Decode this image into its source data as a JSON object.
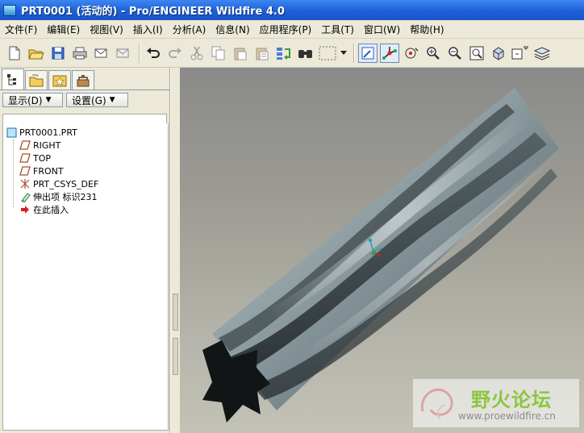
{
  "window": {
    "title": "PRT0001 (活动的) - Pro/ENGINEER Wildfire 4.0"
  },
  "menubar": {
    "items": [
      {
        "label": "文件(F)"
      },
      {
        "label": "编辑(E)"
      },
      {
        "label": "视图(V)"
      },
      {
        "label": "插入(I)"
      },
      {
        "label": "分析(A)"
      },
      {
        "label": "信息(N)"
      },
      {
        "label": "应用程序(P)"
      },
      {
        "label": "工具(T)"
      },
      {
        "label": "窗口(W)"
      },
      {
        "label": "帮助(H)"
      }
    ]
  },
  "toolbar": {
    "icons": [
      "new-icon",
      "open-icon",
      "save-icon",
      "print-icon",
      "send-email-icon",
      "send-link-icon",
      "undo-icon",
      "redo-icon",
      "cut-icon",
      "copy-icon",
      "paste-icon",
      "paste-special-icon",
      "regenerate-icon",
      "find-icon",
      "selection-box-icon",
      "repaint-icon",
      "spin-center-icon",
      "orient-mode-icon",
      "zoom-in-icon",
      "zoom-out-icon",
      "refit-icon",
      "reorient-icon",
      "saved-views-icon",
      "layers-icon"
    ]
  },
  "left_panel": {
    "show_button": "显示(D)",
    "settings_button": "设置(G)"
  },
  "model_tree": {
    "items": [
      {
        "label": "PRT0001.PRT",
        "icon": "part-icon"
      },
      {
        "label": "RIGHT",
        "icon": "datum-plane-icon"
      },
      {
        "label": "TOP",
        "icon": "datum-plane-icon"
      },
      {
        "label": "FRONT",
        "icon": "datum-plane-icon"
      },
      {
        "label": "PRT_CSYS_DEF",
        "icon": "coordinate-system-icon"
      },
      {
        "label": "伸出项 标识231",
        "icon": "protrusion-icon"
      },
      {
        "label": "在此插入",
        "icon": "insert-here-arrow-icon"
      }
    ]
  },
  "watermark": {
    "title": "野火论坛",
    "url": "www.proewildfire.cn"
  },
  "colors": {
    "titlebar": "#1c5fd6",
    "model_steel": "#7d8c91",
    "insert_arrow": "#d81e1e"
  }
}
